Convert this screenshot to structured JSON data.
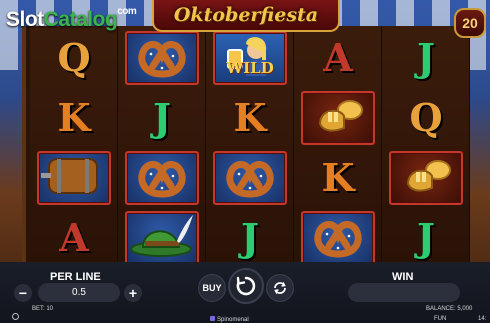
{
  "watermark": {
    "part1": "Slot",
    "part2": "Catalog",
    "part3": "com"
  },
  "game": {
    "title": "Oktoberfiesta",
    "lines": "20"
  },
  "reels": [
    [
      "Q",
      "K",
      "barrel",
      "A"
    ],
    [
      "pretzel",
      "J",
      "pretzel",
      "hat"
    ],
    [
      "wild",
      "K",
      "pretzel",
      "J"
    ],
    [
      "A",
      "tuba",
      "K",
      "pretzel"
    ],
    [
      "J",
      "Q",
      "tuba",
      "J"
    ]
  ],
  "symbol_labels": {
    "wild": "WILD"
  },
  "controls": {
    "per_line_label": "PER LINE",
    "per_line_value": "0.5",
    "minus": "−",
    "plus": "+",
    "buy_label": "BUY",
    "win_label": "WIN"
  },
  "footer": {
    "bet": "BET: 10",
    "balance": "BALANCE: 5,000",
    "mode": "FUN",
    "provider": "Spinomenal",
    "time": "14:"
  },
  "colors": {
    "card_A": "#c0392b",
    "card_K": "#e67e22",
    "card_Q": "#e9a23b",
    "card_J": "#2ecc71",
    "title": "#f4c44a"
  }
}
